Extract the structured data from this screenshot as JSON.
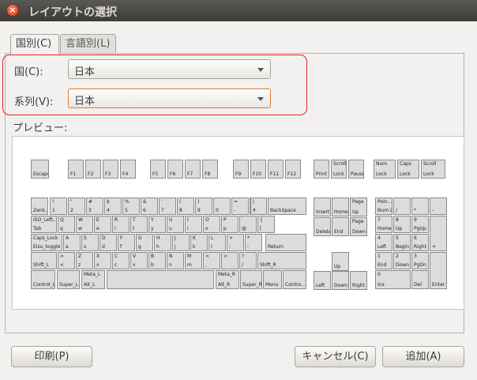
{
  "window": {
    "title": "レイアウトの選択",
    "close_glyph": "×"
  },
  "tabs": [
    {
      "label": "国別(C)",
      "active": true
    },
    {
      "label": "言語別(L)",
      "active": false
    }
  ],
  "form": {
    "country_label": "国(C):",
    "country_value": "日本",
    "variant_label": "系列(V):",
    "variant_value": "日本"
  },
  "preview_label": "プレビュー:",
  "keyboard": {
    "keys": [
      {
        "id": "escape",
        "b": "Escape"
      },
      {
        "id": "f1",
        "b": "F1"
      },
      {
        "id": "f2",
        "b": "F2"
      },
      {
        "id": "f3",
        "b": "F3"
      },
      {
        "id": "f4",
        "b": "F4"
      },
      {
        "id": "f5",
        "b": "F5"
      },
      {
        "id": "f6",
        "b": "F6"
      },
      {
        "id": "f7",
        "b": "F7"
      },
      {
        "id": "f8",
        "b": "F8"
      },
      {
        "id": "f9",
        "b": "F9"
      },
      {
        "id": "f10",
        "b": "F10"
      },
      {
        "id": "f11",
        "b": "F11"
      },
      {
        "id": "f12",
        "b": "F12"
      },
      {
        "id": "print",
        "b": "Print"
      },
      {
        "id": "scroll-lock",
        "t": "Scroll",
        "b": "Lock"
      },
      {
        "id": "pause",
        "b": "Pause"
      },
      {
        "id": "zenkaku",
        "b": "Zenk..."
      },
      {
        "id": "k1",
        "t": "!",
        "b": "1"
      },
      {
        "id": "k2",
        "t": "\"",
        "b": "2"
      },
      {
        "id": "k3",
        "t": "#",
        "b": "3"
      },
      {
        "id": "k4",
        "t": "$",
        "b": "4"
      },
      {
        "id": "k5",
        "t": "%",
        "b": "5"
      },
      {
        "id": "k6",
        "t": "&",
        "b": "6"
      },
      {
        "id": "k7",
        "t": "'",
        "b": "7"
      },
      {
        "id": "k8",
        "t": "(",
        "b": "8"
      },
      {
        "id": "k9",
        "t": ")",
        "b": "9"
      },
      {
        "id": "k0",
        "t": "",
        "b": "0"
      },
      {
        "id": "kminus",
        "t": "=",
        "b": "-"
      },
      {
        "id": "kcaret",
        "t": "~",
        "b": "^"
      },
      {
        "id": "kyen",
        "t": "|",
        "b": "¥"
      },
      {
        "id": "backspace",
        "b": "BackSpace"
      },
      {
        "id": "tab",
        "t": "ISO_Left...",
        "b": "Tab"
      },
      {
        "id": "kq",
        "t": "Q",
        "b": "q"
      },
      {
        "id": "kw",
        "t": "W",
        "b": "w"
      },
      {
        "id": "ke",
        "t": "E",
        "b": "e"
      },
      {
        "id": "kr",
        "t": "R",
        "b": "r"
      },
      {
        "id": "kt",
        "t": "T",
        "b": "t"
      },
      {
        "id": "ky",
        "t": "Y",
        "b": "y"
      },
      {
        "id": "ku",
        "t": "U",
        "b": "u"
      },
      {
        "id": "ki",
        "t": "I",
        "b": "i"
      },
      {
        "id": "ko",
        "t": "O",
        "b": "o"
      },
      {
        "id": "kp",
        "t": "P",
        "b": "p"
      },
      {
        "id": "kat",
        "t": "`",
        "b": "@"
      },
      {
        "id": "klbrace",
        "t": "{",
        "b": "["
      },
      {
        "id": "caps",
        "t": "Caps_Lock",
        "b": "Eisu_toggle"
      },
      {
        "id": "ka",
        "t": "A",
        "b": "a"
      },
      {
        "id": "ks",
        "t": "S",
        "b": "s"
      },
      {
        "id": "kd",
        "t": "D",
        "b": "d"
      },
      {
        "id": "kf",
        "t": "F",
        "b": "f"
      },
      {
        "id": "kg",
        "t": "G",
        "b": "g"
      },
      {
        "id": "kh",
        "t": "H",
        "b": "h"
      },
      {
        "id": "kj",
        "t": "J",
        "b": "j"
      },
      {
        "id": "kk",
        "t": "K",
        "b": "k"
      },
      {
        "id": "kl",
        "t": "L",
        "b": "l"
      },
      {
        "id": "ksemi",
        "t": "+",
        "b": ";"
      },
      {
        "id": "kcolon",
        "t": "*",
        "b": ":"
      },
      {
        "id": "krbrace",
        "t": "}",
        "b": "]"
      },
      {
        "id": "return",
        "b": "Return"
      },
      {
        "id": "shift-l",
        "b": "Shift_L"
      },
      {
        "id": "kgt",
        "t": ">",
        "b": "<"
      },
      {
        "id": "kz",
        "t": "Z",
        "b": "z"
      },
      {
        "id": "kx",
        "t": "X",
        "b": "x"
      },
      {
        "id": "kc",
        "t": "C",
        "b": "c"
      },
      {
        "id": "kv",
        "t": "V",
        "b": "v"
      },
      {
        "id": "kb",
        "t": "B",
        "b": "b"
      },
      {
        "id": "kn",
        "t": "N",
        "b": "n"
      },
      {
        "id": "km",
        "t": "M",
        "b": "m"
      },
      {
        "id": "kcomma",
        "t": "<",
        "b": ","
      },
      {
        "id": "kperiod",
        "t": ">",
        "b": "."
      },
      {
        "id": "kslash",
        "t": "?",
        "b": "/"
      },
      {
        "id": "kbslash",
        "t": "_",
        "b": "\\"
      },
      {
        "id": "shift-r",
        "b": "Shift_R"
      },
      {
        "id": "control-l",
        "b": "Control_L"
      },
      {
        "id": "super-l",
        "b": "Super_L"
      },
      {
        "id": "alt-l",
        "t": "Meta_L",
        "b": "Alt_L"
      },
      {
        "id": "space",
        "b": ""
      },
      {
        "id": "alt-r",
        "t": "Meta_R",
        "b": "Alt_R"
      },
      {
        "id": "super-r",
        "b": "Super_R"
      },
      {
        "id": "menu",
        "b": "Menu"
      },
      {
        "id": "control-r",
        "b": "Contro..."
      },
      {
        "id": "insert",
        "b": "Insert"
      },
      {
        "id": "home",
        "b": "Home"
      },
      {
        "id": "page-up",
        "t": "Page",
        "b": "Up"
      },
      {
        "id": "delete",
        "b": "Delete"
      },
      {
        "id": "end",
        "b": "End"
      },
      {
        "id": "page-down",
        "t": "Page",
        "b": "Down"
      },
      {
        "id": "up",
        "b": "Up"
      },
      {
        "id": "left",
        "b": "Left"
      },
      {
        "id": "down",
        "b": "Down"
      },
      {
        "id": "right",
        "b": "Right"
      },
      {
        "id": "num-lock",
        "t": "Num",
        "b": "Lock"
      },
      {
        "id": "caps-lock-ind",
        "t": "Caps",
        "b": "Lock"
      },
      {
        "id": "scroll-lock-ind",
        "t": "Scroll",
        "b": "Lock"
      },
      {
        "id": "numlock",
        "t": "Poin...",
        "b": "Num Lock"
      },
      {
        "id": "kp-div",
        "b": "/"
      },
      {
        "id": "kp-mul",
        "b": "*"
      },
      {
        "id": "kp-sub",
        "b": "-"
      },
      {
        "id": "kp7",
        "t": "7",
        "b": "Home"
      },
      {
        "id": "kp8",
        "t": "8",
        "b": "Up"
      },
      {
        "id": "kp9",
        "t": "9",
        "b": "PgUp"
      },
      {
        "id": "kp-add",
        "b": "+"
      },
      {
        "id": "kp4",
        "t": "4",
        "b": "Left"
      },
      {
        "id": "kp5",
        "t": "5",
        "b": "Begin"
      },
      {
        "id": "kp6",
        "t": "6",
        "b": "Right"
      },
      {
        "id": "kp1",
        "t": "1",
        "b": "End"
      },
      {
        "id": "kp2",
        "t": "2",
        "b": "Down"
      },
      {
        "id": "kp3",
        "t": "3",
        "b": "PgDn"
      },
      {
        "id": "kp-enter",
        "b": "Enter"
      },
      {
        "id": "kp0",
        "t": "0",
        "b": "Ins"
      },
      {
        "id": "kp-del",
        "b": "Del"
      }
    ]
  },
  "buttons": {
    "print": "印刷(P)",
    "cancel": "キャンセル(C)",
    "add": "追加(A)"
  }
}
